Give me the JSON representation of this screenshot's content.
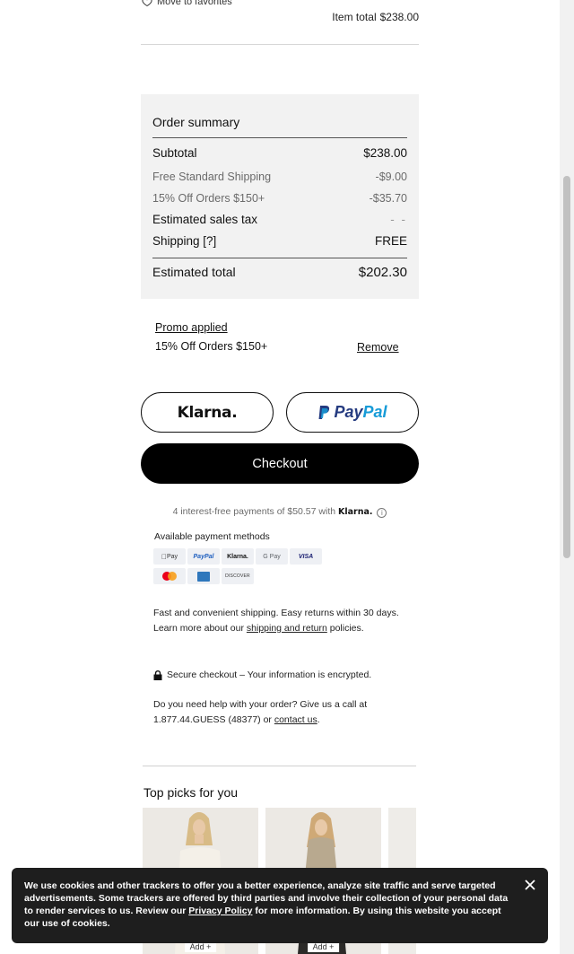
{
  "cart_item": {
    "favorites_label": "Move to favorites",
    "item_total_label": "Item total",
    "item_total_value": "$238.00"
  },
  "order_summary": {
    "title": "Order summary",
    "rows": [
      {
        "label": "Subtotal",
        "value": "$238.00"
      },
      {
        "label": "Free Standard Shipping",
        "value": "-$9.00"
      },
      {
        "label": "15% Off Orders $150+",
        "value": "-$35.70"
      },
      {
        "label": "Estimated sales tax",
        "value": "- -"
      },
      {
        "label": "Shipping [?]",
        "value": "FREE"
      }
    ],
    "total_label": "Estimated total",
    "total_value": "$202.30"
  },
  "promo": {
    "applied_label": "Promo applied",
    "name": "15% Off Orders $150+",
    "remove_label": "Remove"
  },
  "payment_buttons": {
    "klarna": "Klarna.",
    "paypal_a": "Pay",
    "paypal_b": "Pal",
    "checkout": "Checkout"
  },
  "klarna_line": {
    "text": "4 interest-free payments of $50.57 with",
    "brand": "Klarna.",
    "info": "i"
  },
  "payment_methods": {
    "title": "Available payment methods",
    "row1": [
      "Pay",
      "PayPal",
      "Klarna.",
      "G Pay",
      "VISA"
    ],
    "discover": "DISCOVER"
  },
  "info": {
    "shipping_text": "Fast and convenient shipping. Easy returns within 30 days. Learn more about our",
    "shipping_link": "shipping and return",
    "shipping_tail": "policies.",
    "secure_text": "Secure checkout – Your information is encrypted.",
    "help_text": "Do you need help with your order? Give us a call at 1.877.44.GUESS (48377) or",
    "help_link": "contact us",
    "help_tail": "."
  },
  "recommendations": {
    "title": "Top picks for you",
    "add_label": "Add +"
  },
  "cookie_banner": {
    "text_before": "We use cookies and other trackers to offer you a better experience, analyze site traffic and serve targeted advertisements. Some trackers are offered by third parties and involve their collection of your personal data to render services to us. Review our",
    "link": "Privacy Policy",
    "text_after": "for more information. By using this website you accept our use of cookies."
  }
}
